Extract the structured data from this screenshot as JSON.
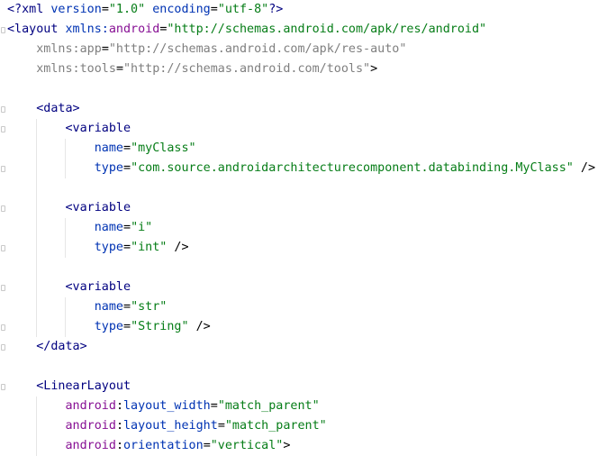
{
  "editor": {
    "language": "xml",
    "lines": [
      {
        "parts": [
          [
            "?",
            "<?"
          ],
          [
            "kw",
            "xml "
          ],
          [
            "an",
            "version"
          ],
          [
            "p",
            "="
          ],
          [
            "av",
            "\"1.0\""
          ],
          [
            "p",
            " "
          ],
          [
            "an",
            "encoding"
          ],
          [
            "p",
            "="
          ],
          [
            "av",
            "\"utf-8\""
          ],
          [
            "?",
            "?>"
          ]
        ]
      },
      {
        "parts": [
          [
            "t",
            "<layout "
          ],
          [
            "an",
            "xmlns:"
          ],
          [
            "ns",
            "android"
          ],
          [
            "p",
            "="
          ],
          [
            "av",
            "\"http://schemas.android.com/apk/res/android\""
          ]
        ]
      },
      {
        "parts": [
          [
            "p",
            "    "
          ],
          [
            "ns2",
            "xmlns:app"
          ],
          [
            "p",
            "="
          ],
          [
            "ns2v",
            "\"http://schemas.android.com/apk/res-auto\""
          ]
        ]
      },
      {
        "parts": [
          [
            "p",
            "    "
          ],
          [
            "ns2",
            "xmlns:tools"
          ],
          [
            "p",
            "="
          ],
          [
            "ns2v",
            "\"http://schemas.android.com/tools\""
          ],
          [
            "p",
            ">"
          ]
        ]
      },
      {
        "parts": []
      },
      {
        "parts": [
          [
            "p",
            "    "
          ],
          [
            "t",
            "<data>"
          ]
        ]
      },
      {
        "parts": [
          [
            "p",
            "        "
          ],
          [
            "t",
            "<variable"
          ]
        ]
      },
      {
        "parts": [
          [
            "p",
            "            "
          ],
          [
            "an",
            "name"
          ],
          [
            "p",
            "="
          ],
          [
            "av",
            "\"myClass\""
          ]
        ]
      },
      {
        "parts": [
          [
            "p",
            "            "
          ],
          [
            "an",
            "type"
          ],
          [
            "p",
            "="
          ],
          [
            "av",
            "\"com.source.androidarchitecturecomponent.databinding.MyClass\""
          ],
          [
            "p",
            " />"
          ]
        ]
      },
      {
        "parts": []
      },
      {
        "parts": [
          [
            "p",
            "        "
          ],
          [
            "t",
            "<variable"
          ]
        ]
      },
      {
        "parts": [
          [
            "p",
            "            "
          ],
          [
            "an",
            "name"
          ],
          [
            "p",
            "="
          ],
          [
            "av",
            "\"i\""
          ]
        ]
      },
      {
        "parts": [
          [
            "p",
            "            "
          ],
          [
            "an",
            "type"
          ],
          [
            "p",
            "="
          ],
          [
            "av",
            "\"int\""
          ],
          [
            "p",
            " />"
          ]
        ]
      },
      {
        "parts": []
      },
      {
        "parts": [
          [
            "p",
            "        "
          ],
          [
            "t",
            "<variable"
          ]
        ]
      },
      {
        "parts": [
          [
            "p",
            "            "
          ],
          [
            "an",
            "name"
          ],
          [
            "p",
            "="
          ],
          [
            "av",
            "\"str\""
          ]
        ]
      },
      {
        "parts": [
          [
            "p",
            "            "
          ],
          [
            "an",
            "type"
          ],
          [
            "p",
            "="
          ],
          [
            "av",
            "\"String\""
          ],
          [
            "p",
            " />"
          ]
        ]
      },
      {
        "parts": [
          [
            "p",
            "    "
          ],
          [
            "t",
            "</data>"
          ]
        ]
      },
      {
        "parts": []
      },
      {
        "parts": [
          [
            "p",
            "    "
          ],
          [
            "t",
            "<LinearLayout"
          ]
        ]
      },
      {
        "parts": [
          [
            "p",
            "        "
          ],
          [
            "ns",
            "android"
          ],
          [
            "p",
            ":"
          ],
          [
            "an",
            "layout_width"
          ],
          [
            "p",
            "="
          ],
          [
            "av",
            "\"match_parent\""
          ]
        ]
      },
      {
        "parts": [
          [
            "p",
            "        "
          ],
          [
            "ns",
            "android"
          ],
          [
            "p",
            ":"
          ],
          [
            "an",
            "layout_height"
          ],
          [
            "p",
            "="
          ],
          [
            "av",
            "\"match_parent\""
          ]
        ]
      },
      {
        "parts": [
          [
            "p",
            "        "
          ],
          [
            "ns",
            "android"
          ],
          [
            "p",
            ":"
          ],
          [
            "an",
            "orientation"
          ],
          [
            "p",
            "="
          ],
          [
            "av",
            "\"vertical\""
          ],
          [
            "p",
            ">"
          ]
        ]
      }
    ]
  },
  "colors": {
    "tag": "#000080",
    "attr_name": "#0033b3",
    "namespace": "#871094",
    "attr_value": "#067d17",
    "xmlns_secondary": "#7f7f7f",
    "background": "#ffffff"
  }
}
